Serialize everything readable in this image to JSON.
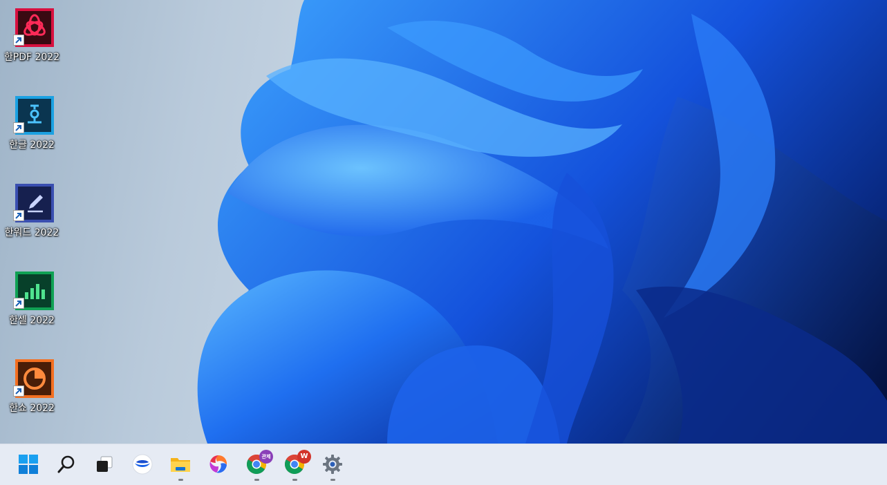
{
  "desktop": {
    "icons": [
      {
        "label": "한PDF 2022",
        "icon": "hanpdf-icon",
        "color": "#d8103f"
      },
      {
        "label": "한글 2022",
        "icon": "hangul-icon",
        "color": "#1ba1e2"
      },
      {
        "label": "한워드 2022",
        "icon": "hanword-icon",
        "color": "#3a4fb0"
      },
      {
        "label": "한셀 2022",
        "icon": "hancell-icon",
        "color": "#10a154"
      },
      {
        "label": "한쇼 2022",
        "icon": "hanshow-icon",
        "color": "#f36f21"
      }
    ]
  },
  "taskbar": {
    "items": [
      {
        "name": "start",
        "icon": "windows-logo-icon",
        "running": false
      },
      {
        "name": "search",
        "icon": "search-icon",
        "running": false
      },
      {
        "name": "task-view",
        "icon": "task-view-icon",
        "running": false
      },
      {
        "name": "app",
        "icon": "blue-white-app-icon",
        "running": false
      },
      {
        "name": "file-explorer",
        "icon": "folder-icon",
        "running": true
      },
      {
        "name": "app",
        "icon": "colorful-swirl-app-icon",
        "running": false
      },
      {
        "name": "chrome-profile",
        "icon": "chrome-icon",
        "badge": "관제",
        "running": true
      },
      {
        "name": "chrome-profile",
        "icon": "chrome-icon",
        "badge": "W",
        "running": true
      },
      {
        "name": "settings",
        "icon": "gear-icon",
        "running": true
      }
    ]
  },
  "colors": {
    "taskbar_bg": "#e6ebf4",
    "wallpaper_blue": "#1a5fe8",
    "badge_purple": "#8a3fb8",
    "badge_red": "#d2342a"
  }
}
